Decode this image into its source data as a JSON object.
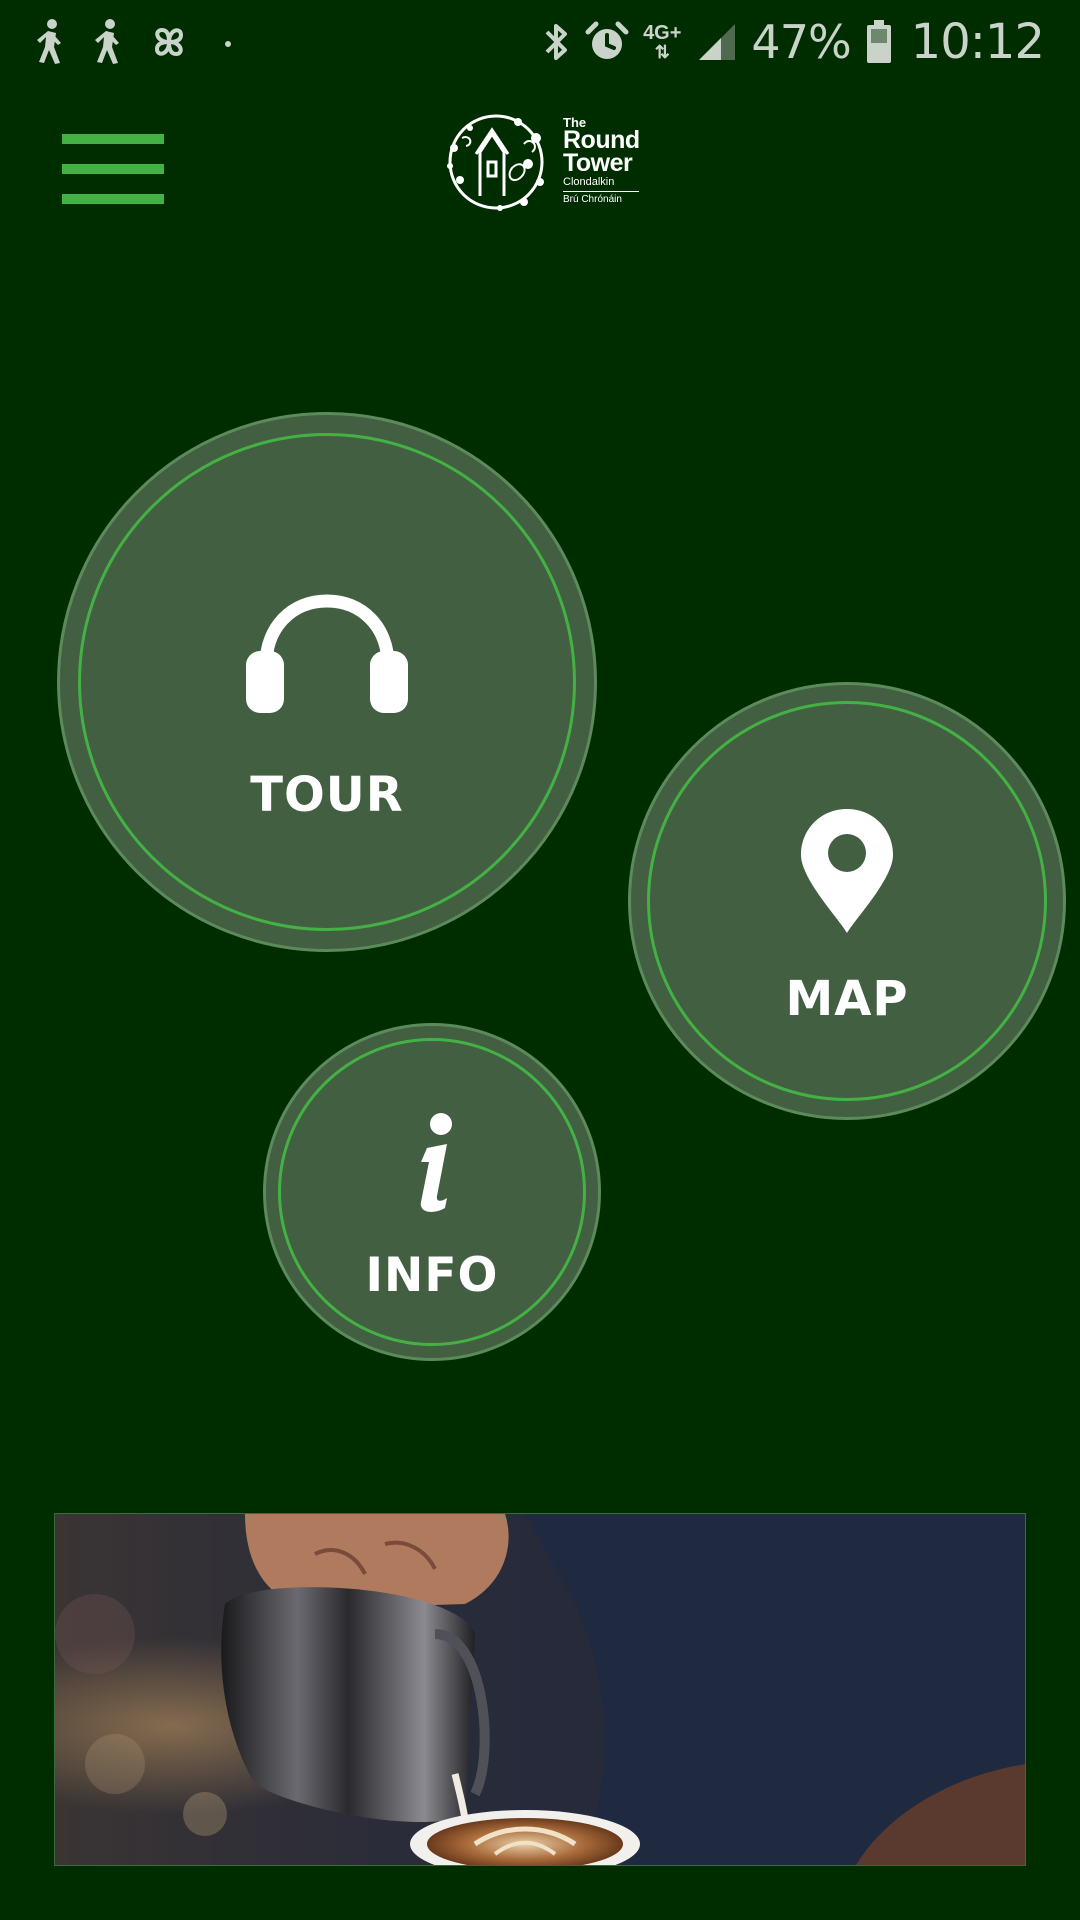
{
  "status_bar": {
    "left_icons": [
      "walking-person-icon",
      "walking-person-icon",
      "pinwheel-icon",
      "dot-icon"
    ],
    "right_icons": [
      "bluetooth-icon",
      "alarm-clock-icon",
      "network-type-icon",
      "signal-icon",
      "battery-icon"
    ],
    "network_type": "4G+",
    "network_arrows": "⇅",
    "battery_percent": "47%",
    "time": "10:12"
  },
  "header": {
    "menu_icon": "hamburger-menu-icon",
    "logo": {
      "line_the": "The",
      "line_round": "Round",
      "line_tower": "Tower",
      "line_place": "Clondalkin",
      "line_irish": "Brú Chrónáin"
    }
  },
  "buttons": {
    "tour": {
      "label": "TOUR",
      "icon": "headphones-icon"
    },
    "map": {
      "label": "MAP",
      "icon": "map-pin-icon"
    },
    "info": {
      "label": "INFO",
      "icon": "info-icon"
    }
  },
  "banner": {
    "image": "barista-pouring-latte-art-photo"
  },
  "colors": {
    "background": "#002d00",
    "accent_green": "#44b144",
    "circle_fill": "#425f42",
    "text": "#ffffff",
    "status_text": "#c9d3c9"
  }
}
